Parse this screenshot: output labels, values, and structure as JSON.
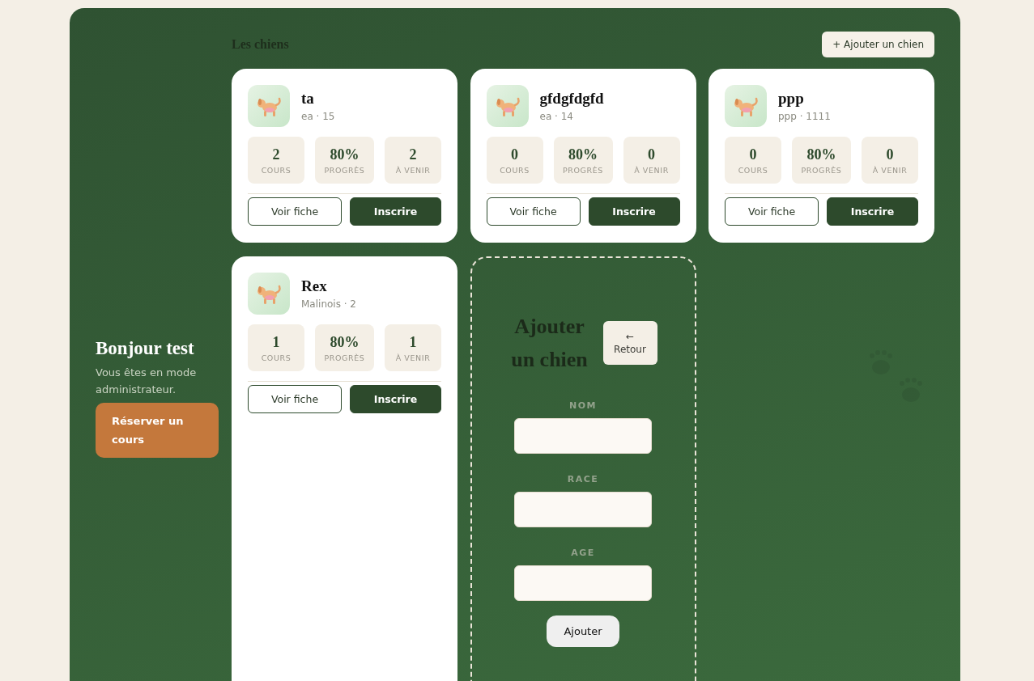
{
  "header": {
    "title": "Les chiens",
    "add_button": "+ Ajouter un chien"
  },
  "sidebar": {
    "greeting": "Bonjour test",
    "note": "Vous êtes en mode administrateur.",
    "book_button": "Réserver un cours"
  },
  "dogs": [
    {
      "name": "ta",
      "meta": "ea · 15",
      "stats": [
        {
          "value": "2",
          "label": "COURS"
        },
        {
          "value": "80%",
          "label": "PROGRÈS"
        },
        {
          "value": "2",
          "label": "À VENIR"
        }
      ],
      "view_button": "Voir fiche",
      "enroll_button": "Inscrire"
    },
    {
      "name": "gfdgfdgfd",
      "meta": "ea · 14",
      "stats": [
        {
          "value": "0",
          "label": "COURS"
        },
        {
          "value": "80%",
          "label": "PROGRÈS"
        },
        {
          "value": "0",
          "label": "À VENIR"
        }
      ],
      "view_button": "Voir fiche",
      "enroll_button": "Inscrire"
    },
    {
      "name": "ppp",
      "meta": "ppp · 1111",
      "stats": [
        {
          "value": "0",
          "label": "COURS"
        },
        {
          "value": "80%",
          "label": "PROGRÈS"
        },
        {
          "value": "0",
          "label": "À VENIR"
        }
      ],
      "view_button": "Voir fiche",
      "enroll_button": "Inscrire"
    },
    {
      "name": "Rex",
      "meta": "Malinois · 2",
      "stats": [
        {
          "value": "1",
          "label": "COURS"
        },
        {
          "value": "80%",
          "label": "PROGRÈS"
        },
        {
          "value": "1",
          "label": "À VENIR"
        }
      ],
      "view_button": "Voir fiche",
      "enroll_button": "Inscrire"
    }
  ],
  "form": {
    "title": "Ajouter un chien",
    "back_arrow": "←",
    "back_label": "Retour",
    "fields": [
      {
        "label": "NOM"
      },
      {
        "label": "RACE"
      },
      {
        "label": "AGE"
      }
    ],
    "submit": "Ajouter"
  }
}
